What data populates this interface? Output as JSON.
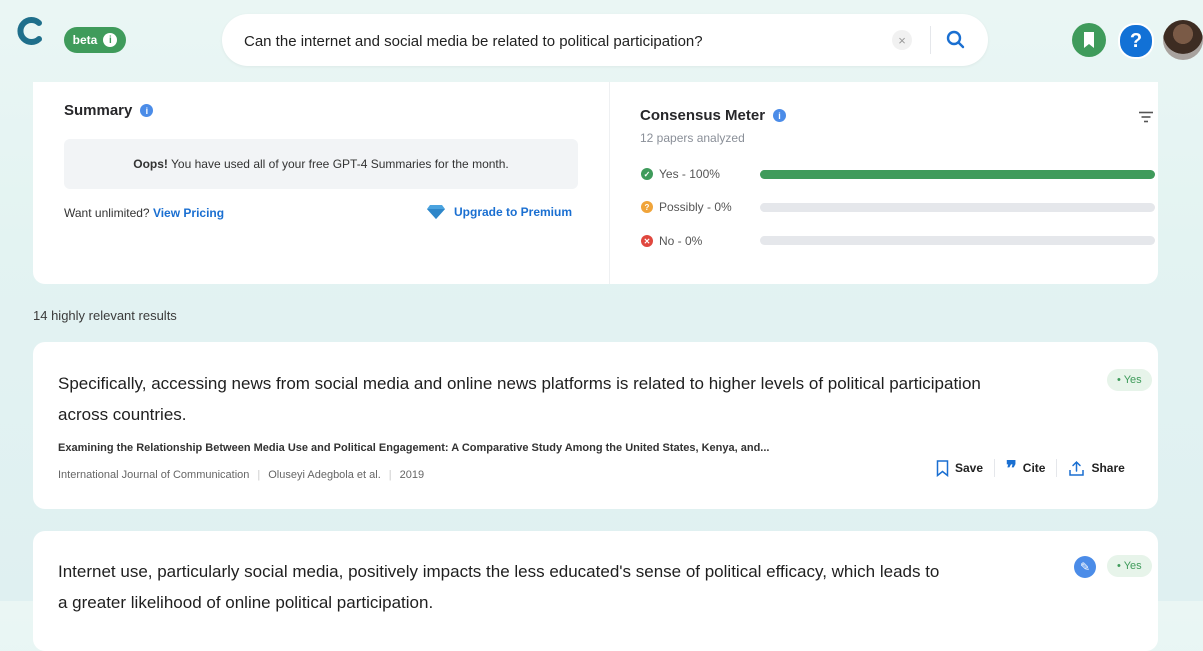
{
  "header": {
    "logo_icon": "consensus-logo-icon",
    "beta_label": "beta",
    "search_value": "Can the internet and social media be related to political participation?",
    "clear_icon": "close-icon",
    "search_icon": "search-icon"
  },
  "summary": {
    "title": "Summary",
    "info_icon": "i",
    "oops_bold": "Oops!",
    "oops_text": " You have used all of your free GPT-4 Summaries for the month.",
    "unlimited_text": "Want unlimited? ",
    "view_pricing": "View Pricing",
    "upgrade": "Upgrade to Premium"
  },
  "meter": {
    "title": "Consensus Meter",
    "subtitle": "12 papers analyzed",
    "rows": [
      {
        "label": "Yes - 100%",
        "value": 1.0,
        "color": "#3f9b5b"
      },
      {
        "label": "Possibly - 0%",
        "value": 0.0,
        "color": "#f0a43a"
      },
      {
        "label": "No - 0%",
        "value": 0.0,
        "color": "#e0473e"
      }
    ]
  },
  "results": {
    "count_text": "14 highly relevant results",
    "items": [
      {
        "claim_line1": "Specifically, accessing news from social media and online news platforms is related to higher levels of political participation",
        "claim_line2": "across countries.",
        "paper_title": "Examining the Relationship Between Media Use and Political Engagement: A Comparative Study Among the United States, Kenya, and...",
        "journal": "International Journal of Communication",
        "authors": "Oluseyi Adegbola et al.",
        "year": "2019",
        "badge": "• Yes",
        "save": "Save",
        "cite": "Cite",
        "share": "Share"
      },
      {
        "claim_line1": "Internet use, particularly social media, positively impacts the less educated's sense of political efficacy, which leads to",
        "claim_line2": "a greater likelihood of online political participation.",
        "badge": "• Yes"
      }
    ]
  }
}
